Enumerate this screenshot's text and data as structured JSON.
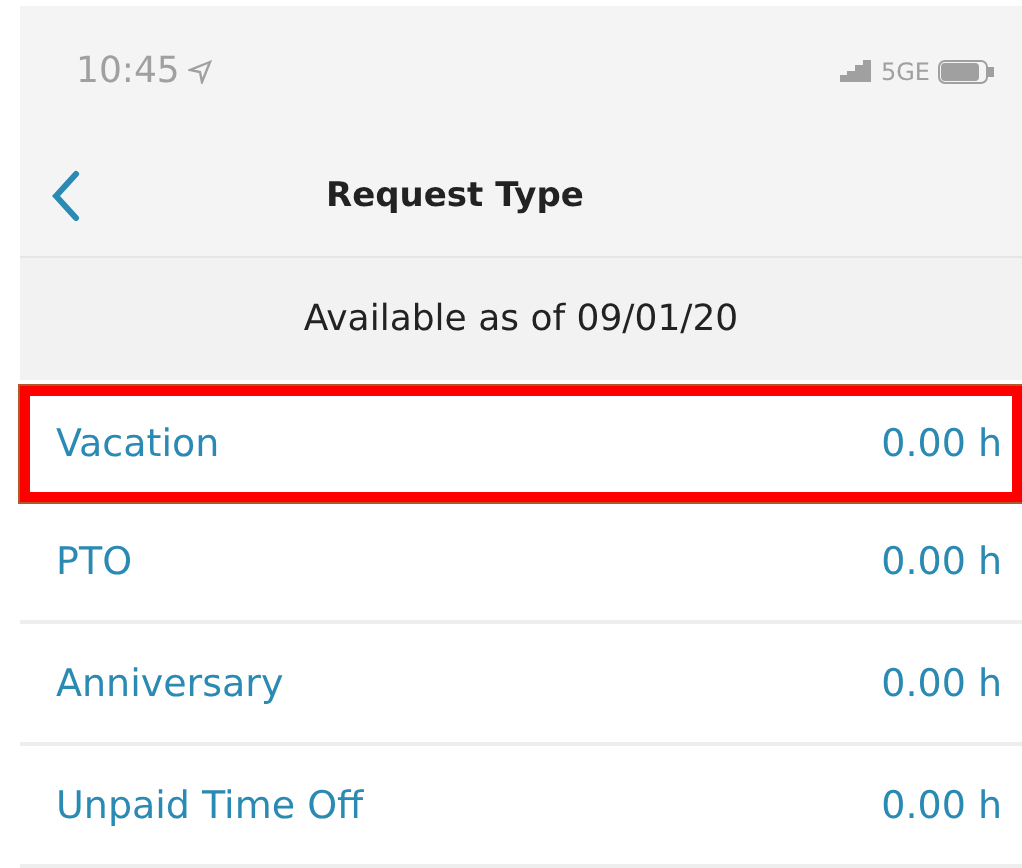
{
  "status_bar": {
    "time": "10:45",
    "network": "5GE"
  },
  "header": {
    "title": "Request Type"
  },
  "available": "Available as of 09/01/20",
  "rows": [
    {
      "name": "Vacation",
      "hours": "0.00 h",
      "highlighted": true
    },
    {
      "name": "PTO",
      "hours": "0.00 h",
      "highlighted": false
    },
    {
      "name": "Anniversary",
      "hours": "0.00 h",
      "highlighted": false
    },
    {
      "name": "Unpaid Time Off",
      "hours": "0.00 h",
      "highlighted": false
    }
  ]
}
